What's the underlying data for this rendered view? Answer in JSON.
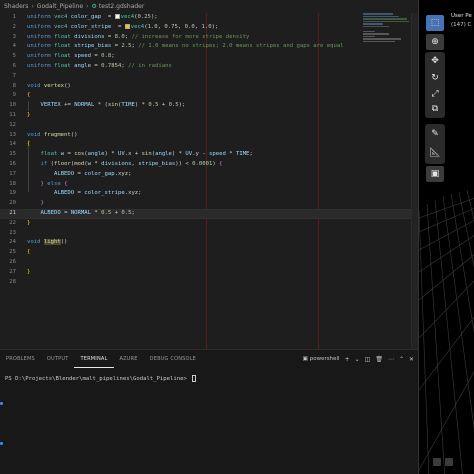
{
  "breadcrumb": [
    "Shaders",
    "Godalt_Pipeline",
    "test2.gdshader"
  ],
  "code_lines": [
    {
      "n": "1",
      "segs": [
        [
          "kw",
          "uniform "
        ],
        [
          "ty",
          "vec4 "
        ],
        [
          "vr",
          "color_gap"
        ],
        [
          "",
          "  = "
        ],
        [
          "sw",
          "#ffffff"
        ],
        [
          "ty",
          "vec4"
        ],
        [
          "",
          "("
        ],
        [
          "nm",
          "0.25"
        ],
        [
          "",
          ");"
        ]
      ]
    },
    {
      "n": "2",
      "segs": [
        [
          "kw",
          "uniform "
        ],
        [
          "ty",
          "vec4 "
        ],
        [
          "vr",
          "color_stripe"
        ],
        [
          "",
          "  = "
        ],
        [
          "sw",
          "#ffbf00"
        ],
        [
          "ty",
          "vec4"
        ],
        [
          "",
          "("
        ],
        [
          "nm",
          "1.0"
        ],
        [
          "",
          ", "
        ],
        [
          "nm",
          "0.75"
        ],
        [
          "",
          ", "
        ],
        [
          "nm",
          "0.0"
        ],
        [
          "",
          ", "
        ],
        [
          "nm",
          "1.0"
        ],
        [
          "",
          ");"
        ]
      ]
    },
    {
      "n": "3",
      "segs": [
        [
          "kw",
          "uniform "
        ],
        [
          "ty",
          "float "
        ],
        [
          "vr",
          "divisions"
        ],
        [
          "",
          " = "
        ],
        [
          "nm",
          "8.0"
        ],
        [
          "",
          "; "
        ],
        [
          "cm",
          "// increase for more stripe density"
        ]
      ]
    },
    {
      "n": "4",
      "segs": [
        [
          "kw",
          "uniform "
        ],
        [
          "ty",
          "float "
        ],
        [
          "vr",
          "stripe_bias"
        ],
        [
          "",
          " = "
        ],
        [
          "nm",
          "2.5"
        ],
        [
          "",
          "; "
        ],
        [
          "cm",
          "// 1.0 means no stripes; 2.0 means stripes and gaps are equal"
        ]
      ]
    },
    {
      "n": "5",
      "segs": [
        [
          "kw",
          "uniform "
        ],
        [
          "ty",
          "float "
        ],
        [
          "vr",
          "speed"
        ],
        [
          "",
          " = "
        ],
        [
          "nm",
          "0.8"
        ],
        [
          "",
          ";"
        ]
      ]
    },
    {
      "n": "6",
      "segs": [
        [
          "kw",
          "uniform "
        ],
        [
          "ty",
          "float "
        ],
        [
          "vr",
          "angle"
        ],
        [
          "",
          " = "
        ],
        [
          "nm",
          "0.7854"
        ],
        [
          "",
          "; "
        ],
        [
          "cm",
          "// in radians"
        ]
      ]
    },
    {
      "n": "7",
      "segs": []
    },
    {
      "n": "8",
      "segs": [
        [
          "kw",
          "void "
        ],
        [
          "fn",
          "vertex"
        ],
        [
          "",
          "() "
        ]
      ]
    },
    {
      "n": "9",
      "segs": [
        [
          "br",
          "{"
        ]
      ]
    },
    {
      "n": "10",
      "segs": [
        [
          "",
          "    "
        ],
        [
          "vr",
          "VERTEX"
        ],
        [
          "",
          " += "
        ],
        [
          "vr",
          "NORMAL"
        ],
        [
          "",
          " * ("
        ],
        [
          "fn",
          "sin"
        ],
        [
          "",
          "("
        ],
        [
          "vr",
          "TIME"
        ],
        [
          "",
          ") * "
        ],
        [
          "nm",
          "0.5"
        ],
        [
          "",
          " + "
        ],
        [
          "nm",
          "0.5"
        ],
        [
          "",
          ");"
        ]
      ]
    },
    {
      "n": "11",
      "segs": [
        [
          "br",
          "}"
        ]
      ]
    },
    {
      "n": "12",
      "segs": []
    },
    {
      "n": "13",
      "segs": [
        [
          "kw",
          "void "
        ],
        [
          "fn",
          "fragment"
        ],
        [
          "",
          "()"
        ]
      ]
    },
    {
      "n": "14",
      "segs": [
        [
          "br",
          "{"
        ]
      ]
    },
    {
      "n": "15",
      "segs": [
        [
          "",
          "    "
        ],
        [
          "ty",
          "float "
        ],
        [
          "vr",
          "w"
        ],
        [
          "",
          " = "
        ],
        [
          "fn",
          "cos"
        ],
        [
          "",
          "("
        ],
        [
          "vr",
          "angle"
        ],
        [
          "",
          ") * "
        ],
        [
          "vr",
          "UV"
        ],
        [
          "",
          ".x + "
        ],
        [
          "fn",
          "sin"
        ],
        [
          "",
          "("
        ],
        [
          "vr",
          "angle"
        ],
        [
          "",
          ") * "
        ],
        [
          "vr",
          "UV"
        ],
        [
          "",
          ".y - "
        ],
        [
          "vr",
          "speed"
        ],
        [
          "",
          " * "
        ],
        [
          "vr",
          "TIME"
        ],
        [
          "",
          ";"
        ]
      ]
    },
    {
      "n": "16",
      "segs": [
        [
          "",
          "    "
        ],
        [
          "kw",
          "if "
        ],
        [
          "",
          "("
        ],
        [
          "fn",
          "floor"
        ],
        [
          "",
          "("
        ],
        [
          "fn",
          "mod"
        ],
        [
          "",
          "("
        ],
        [
          "vr",
          "w"
        ],
        [
          "",
          " * "
        ],
        [
          "vr",
          "divisions"
        ],
        [
          "",
          ", "
        ],
        [
          "vr",
          "stripe_bias"
        ],
        [
          "",
          ")) < "
        ],
        [
          "nm",
          "0.0001"
        ],
        [
          "",
          ") "
        ],
        [
          "pn",
          "{"
        ]
      ]
    },
    {
      "n": "17",
      "segs": [
        [
          "",
          "        "
        ],
        [
          "vr",
          "ALBEDO"
        ],
        [
          "",
          " = "
        ],
        [
          "vr",
          "color_gap"
        ],
        [
          "",
          ".xyz;"
        ]
      ]
    },
    {
      "n": "18",
      "segs": [
        [
          "",
          "    "
        ],
        [
          "pn",
          "}"
        ],
        [
          "",
          " "
        ],
        [
          "kw",
          "else "
        ],
        [
          "pn",
          "{"
        ]
      ]
    },
    {
      "n": "19",
      "segs": [
        [
          "",
          "        "
        ],
        [
          "vr",
          "ALBEDO"
        ],
        [
          "",
          " = "
        ],
        [
          "vr",
          "color_stripe"
        ],
        [
          "",
          ".xyz;"
        ]
      ]
    },
    {
      "n": "20",
      "segs": [
        [
          "",
          "    "
        ],
        [
          "pn",
          "}"
        ]
      ]
    },
    {
      "n": "21",
      "segs": [
        [
          "",
          "    "
        ],
        [
          "vr",
          "ALBEDO"
        ],
        [
          "",
          " = "
        ],
        [
          "vr",
          "NORMAL"
        ],
        [
          "",
          " * "
        ],
        [
          "nm",
          "0.5"
        ],
        [
          "",
          " + "
        ],
        [
          "nm",
          "0.5"
        ],
        [
          "",
          ";"
        ]
      ],
      "current": true
    },
    {
      "n": "22",
      "segs": [
        [
          "br",
          "}"
        ]
      ]
    },
    {
      "n": "23",
      "segs": []
    },
    {
      "n": "24",
      "segs": [
        [
          "kw",
          "void "
        ],
        [
          "hl",
          "light"
        ],
        [
          "",
          "()"
        ]
      ]
    },
    {
      "n": "25",
      "segs": [
        [
          "br",
          "{"
        ]
      ]
    },
    {
      "n": "26",
      "segs": []
    },
    {
      "n": "27",
      "segs": [
        [
          "br",
          "}"
        ]
      ]
    },
    {
      "n": "28",
      "segs": []
    }
  ],
  "panel": {
    "tabs": [
      "PROBLEMS",
      "OUTPUT",
      "TERMINAL",
      "AZURE",
      "DEBUG CONSOLE"
    ],
    "active_tab": "TERMINAL",
    "shell_label": "powershell",
    "prompt": "PS D:\\Projects\\Blender\\malt_pipelines\\Godalt_Pipeline> "
  },
  "viewport": {
    "title": "User Pe",
    "subtitle": "(147) C"
  },
  "colors": {
    "editor_bg": "#1e1e1e",
    "panel_bg": "#181818",
    "keyword": "#569cd6",
    "type": "#4ec9b0",
    "function": "#dcdcaa",
    "number": "#b5cea8",
    "comment": "#6a9955",
    "variable": "#9cdcfe",
    "blender_selected": "#4772b3"
  },
  "icons": [
    "cursor-icon",
    "transform-icon",
    "rotate-icon",
    "scale-icon",
    "transform-all-icon",
    "annotate-icon",
    "measure-icon",
    "add-cube-icon"
  ]
}
